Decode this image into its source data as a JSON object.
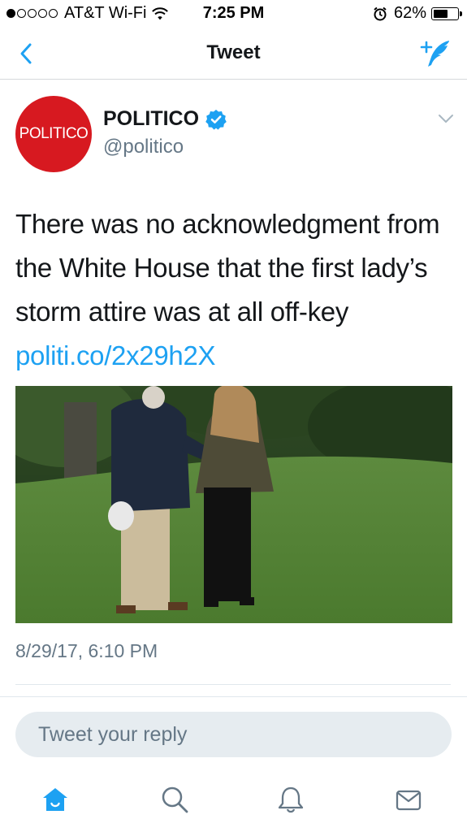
{
  "status_bar": {
    "carrier": "AT&T Wi-Fi",
    "time": "7:25 PM",
    "battery": "62%",
    "battery_level": 0.62,
    "signal_bars_filled": 1,
    "signal_bars_total": 5
  },
  "nav": {
    "title": "Tweet",
    "back_icon": "chevron-left-icon",
    "compose_icon": "compose-tweet-icon"
  },
  "tweet": {
    "avatar_text": "POLITICO",
    "display_name": "POLITICO",
    "handle": "@politico",
    "verified": true,
    "text": "There was no acknowledgment from the White House that the first lady’s storm attire was at all off-key ",
    "link": "politi.co/2x29h2X",
    "timestamp": "8/29/17, 6:10 PM"
  },
  "reply": {
    "placeholder": "Tweet your reply"
  },
  "tabbar": {
    "items": [
      "home-icon",
      "search-icon",
      "notifications-icon",
      "messages-icon"
    ],
    "active": "home-icon"
  },
  "colors": {
    "accent": "#1da1f2",
    "brand_red": "#d71920",
    "secondary_text": "#657786"
  }
}
